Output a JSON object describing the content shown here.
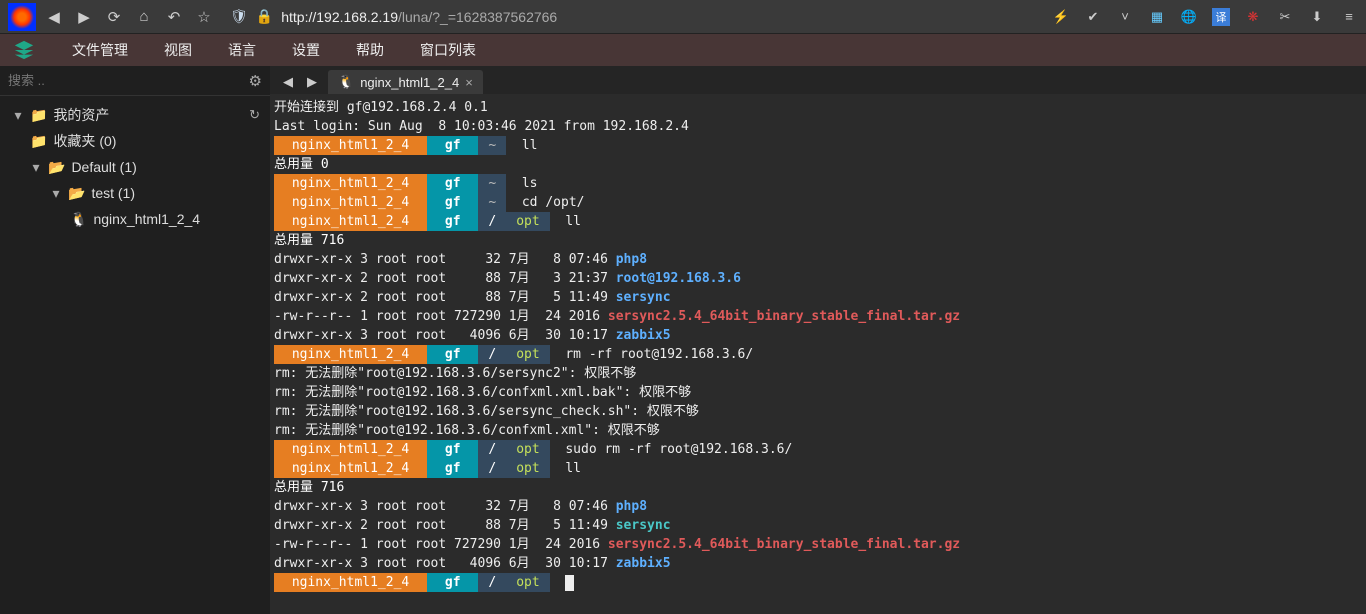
{
  "browser": {
    "url_scheme": "http://",
    "url_host": "192.168.2.19",
    "url_path": "/luna/?_=1628387562766"
  },
  "menu": [
    "文件管理",
    "视图",
    "语言",
    "设置",
    "帮助",
    "窗口列表"
  ],
  "sidebar": {
    "search_placeholder": "搜索 ..",
    "root": "我的资产",
    "fav": "收藏夹 (0)",
    "default": "Default (1)",
    "test": "test (1)",
    "leaf": "nginx_html1_2_4"
  },
  "tab": {
    "title": "nginx_html1_2_4"
  },
  "term": {
    "connect": "开始连接到 gf@192.168.2.4 0.1",
    "lastlogin": "Last login: Sun Aug  8 10:03:46 2021 from 192.168.2.4",
    "host": "nginx_html1_2_4",
    "user": "gf",
    "home": "~",
    "slash": "/",
    "opt": "opt",
    "total0": "总用量 0",
    "total716": "总用量 716",
    "cmd_ll": "ll",
    "cmd_ls": "ls",
    "cmd_cdopt": "cd /opt/",
    "cmd_rmrf": "rm -rf root@192.168.3.6/",
    "cmd_sudorm": "sudo rm -rf root@192.168.3.6/",
    "ls1": [
      {
        "perm": "drwxr-xr-x 3 root root     32 7月   8 07:46",
        "name": "php8",
        "cls": "blue"
      },
      {
        "perm": "drwxr-xr-x 2 root root     88 7月   3 21:37",
        "name": "root@192.168.3.6",
        "cls": "blue"
      },
      {
        "perm": "drwxr-xr-x 2 root root     88 7月   5 11:49",
        "name": "sersync",
        "cls": "blue"
      },
      {
        "perm": "-rw-r--r-- 1 root root 727290 1月  24 2016",
        "name": "sersync2.5.4_64bit_binary_stable_final.tar.gz",
        "cls": "red"
      },
      {
        "perm": "drwxr-xr-x 3 root root   4096 6月  30 10:17",
        "name": "zabbix5",
        "cls": "blue"
      }
    ],
    "rmout": [
      "rm: 无法删除\"root@192.168.3.6/sersync2\": 权限不够",
      "rm: 无法删除\"root@192.168.3.6/confxml.xml.bak\": 权限不够",
      "rm: 无法删除\"root@192.168.3.6/sersync_check.sh\": 权限不够",
      "rm: 无法删除\"root@192.168.3.6/confxml.xml\": 权限不够"
    ],
    "ls2": [
      {
        "perm": "drwxr-xr-x 3 root root     32 7月   8 07:46",
        "name": "php8",
        "cls": "blue"
      },
      {
        "perm": "drwxr-xr-x 2 root root     88 7月   5 11:49",
        "name": "sersync",
        "cls": "teal"
      },
      {
        "perm": "-rw-r--r-- 1 root root 727290 1月  24 2016",
        "name": "sersync2.5.4_64bit_binary_stable_final.tar.gz",
        "cls": "red"
      },
      {
        "perm": "drwxr-xr-x 3 root root   4096 6月  30 10:17",
        "name": "zabbix5",
        "cls": "blue"
      }
    ]
  }
}
